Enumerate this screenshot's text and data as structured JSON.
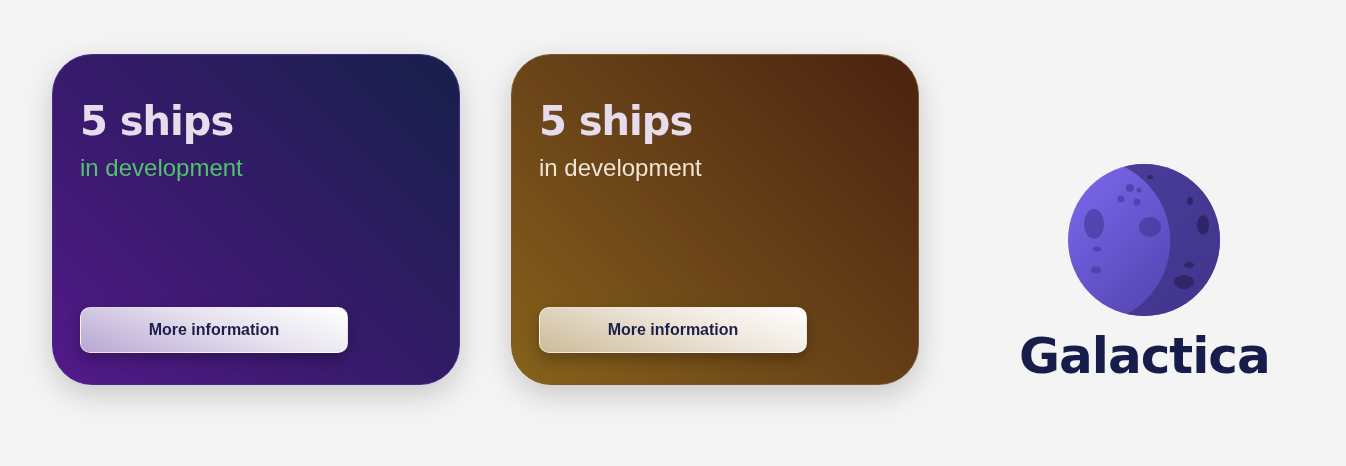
{
  "cards": [
    {
      "kind": "purple",
      "title": "5 ships",
      "subtitle": "in development",
      "button": "More information"
    },
    {
      "kind": "amber",
      "title": "5 ships",
      "subtitle": "in development",
      "button": "More information"
    }
  ],
  "logo": {
    "name": "Galactica"
  }
}
